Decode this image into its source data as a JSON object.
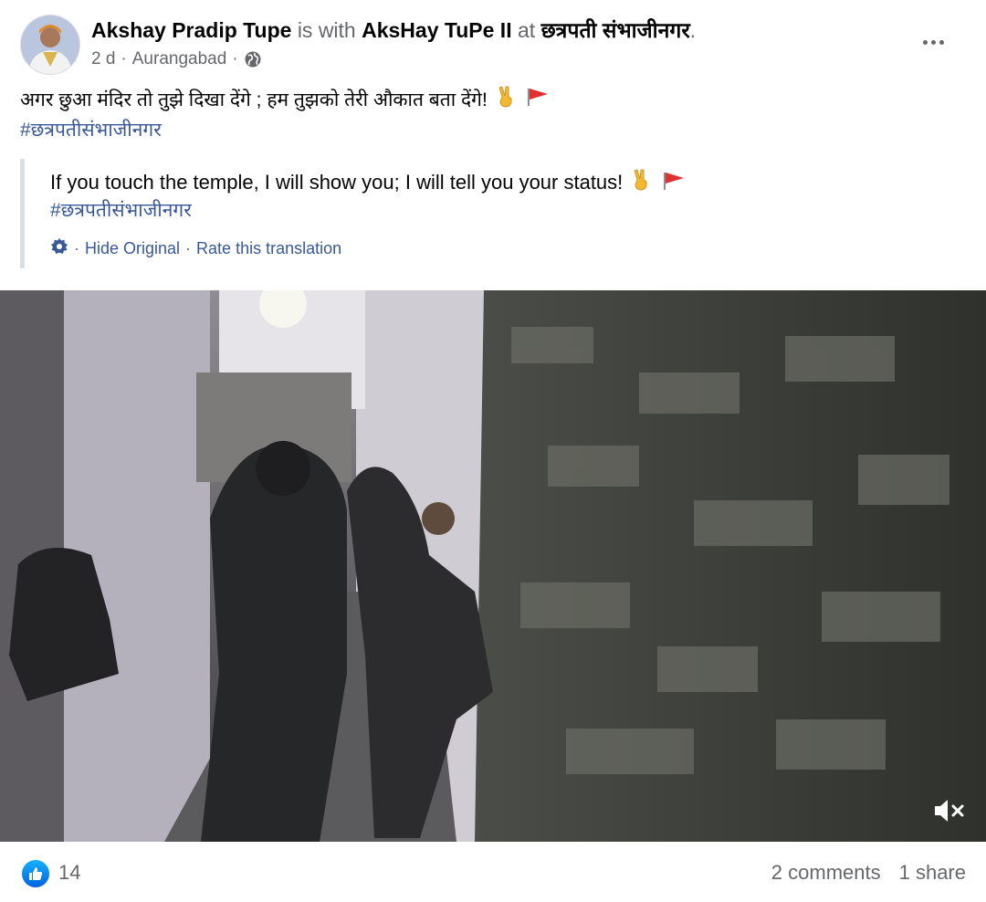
{
  "post": {
    "author": "Akshay Pradip Tupe",
    "with_text": "is with",
    "tagged": "AksHay TuPe II",
    "at_text": "at",
    "location": "छत्रपती संभाजीनगर",
    "end_punct": ".",
    "time": "2 d",
    "dot": "·",
    "place": "Aurangabad",
    "text": "अगर छुआ मंदिर तो तुझे दिखा देंगे ; हम तुझको तेरी औकात बता देंगे!",
    "hashtag": "#छत्रपतीसंभाजीनगर"
  },
  "translation": {
    "text": "If you touch the temple, I will show you; I will tell you your status!",
    "hashtag": "#छत्रपतीसंभाजीनगर",
    "hide_label": "Hide Original",
    "rate_label": "Rate this translation",
    "sep": "·"
  },
  "footer": {
    "likes": "14",
    "comments": "2 comments",
    "shares": "1 share"
  },
  "colors": {
    "link": "#385898",
    "muted": "#65676b",
    "like_blue": "#0062df",
    "flag_red": "#e0302f"
  },
  "icons": [
    "globe-icon",
    "more-options-icon",
    "gear-icon",
    "victory-hand-emoji",
    "red-flag-emoji",
    "like-icon",
    "muted-volume-icon"
  ]
}
